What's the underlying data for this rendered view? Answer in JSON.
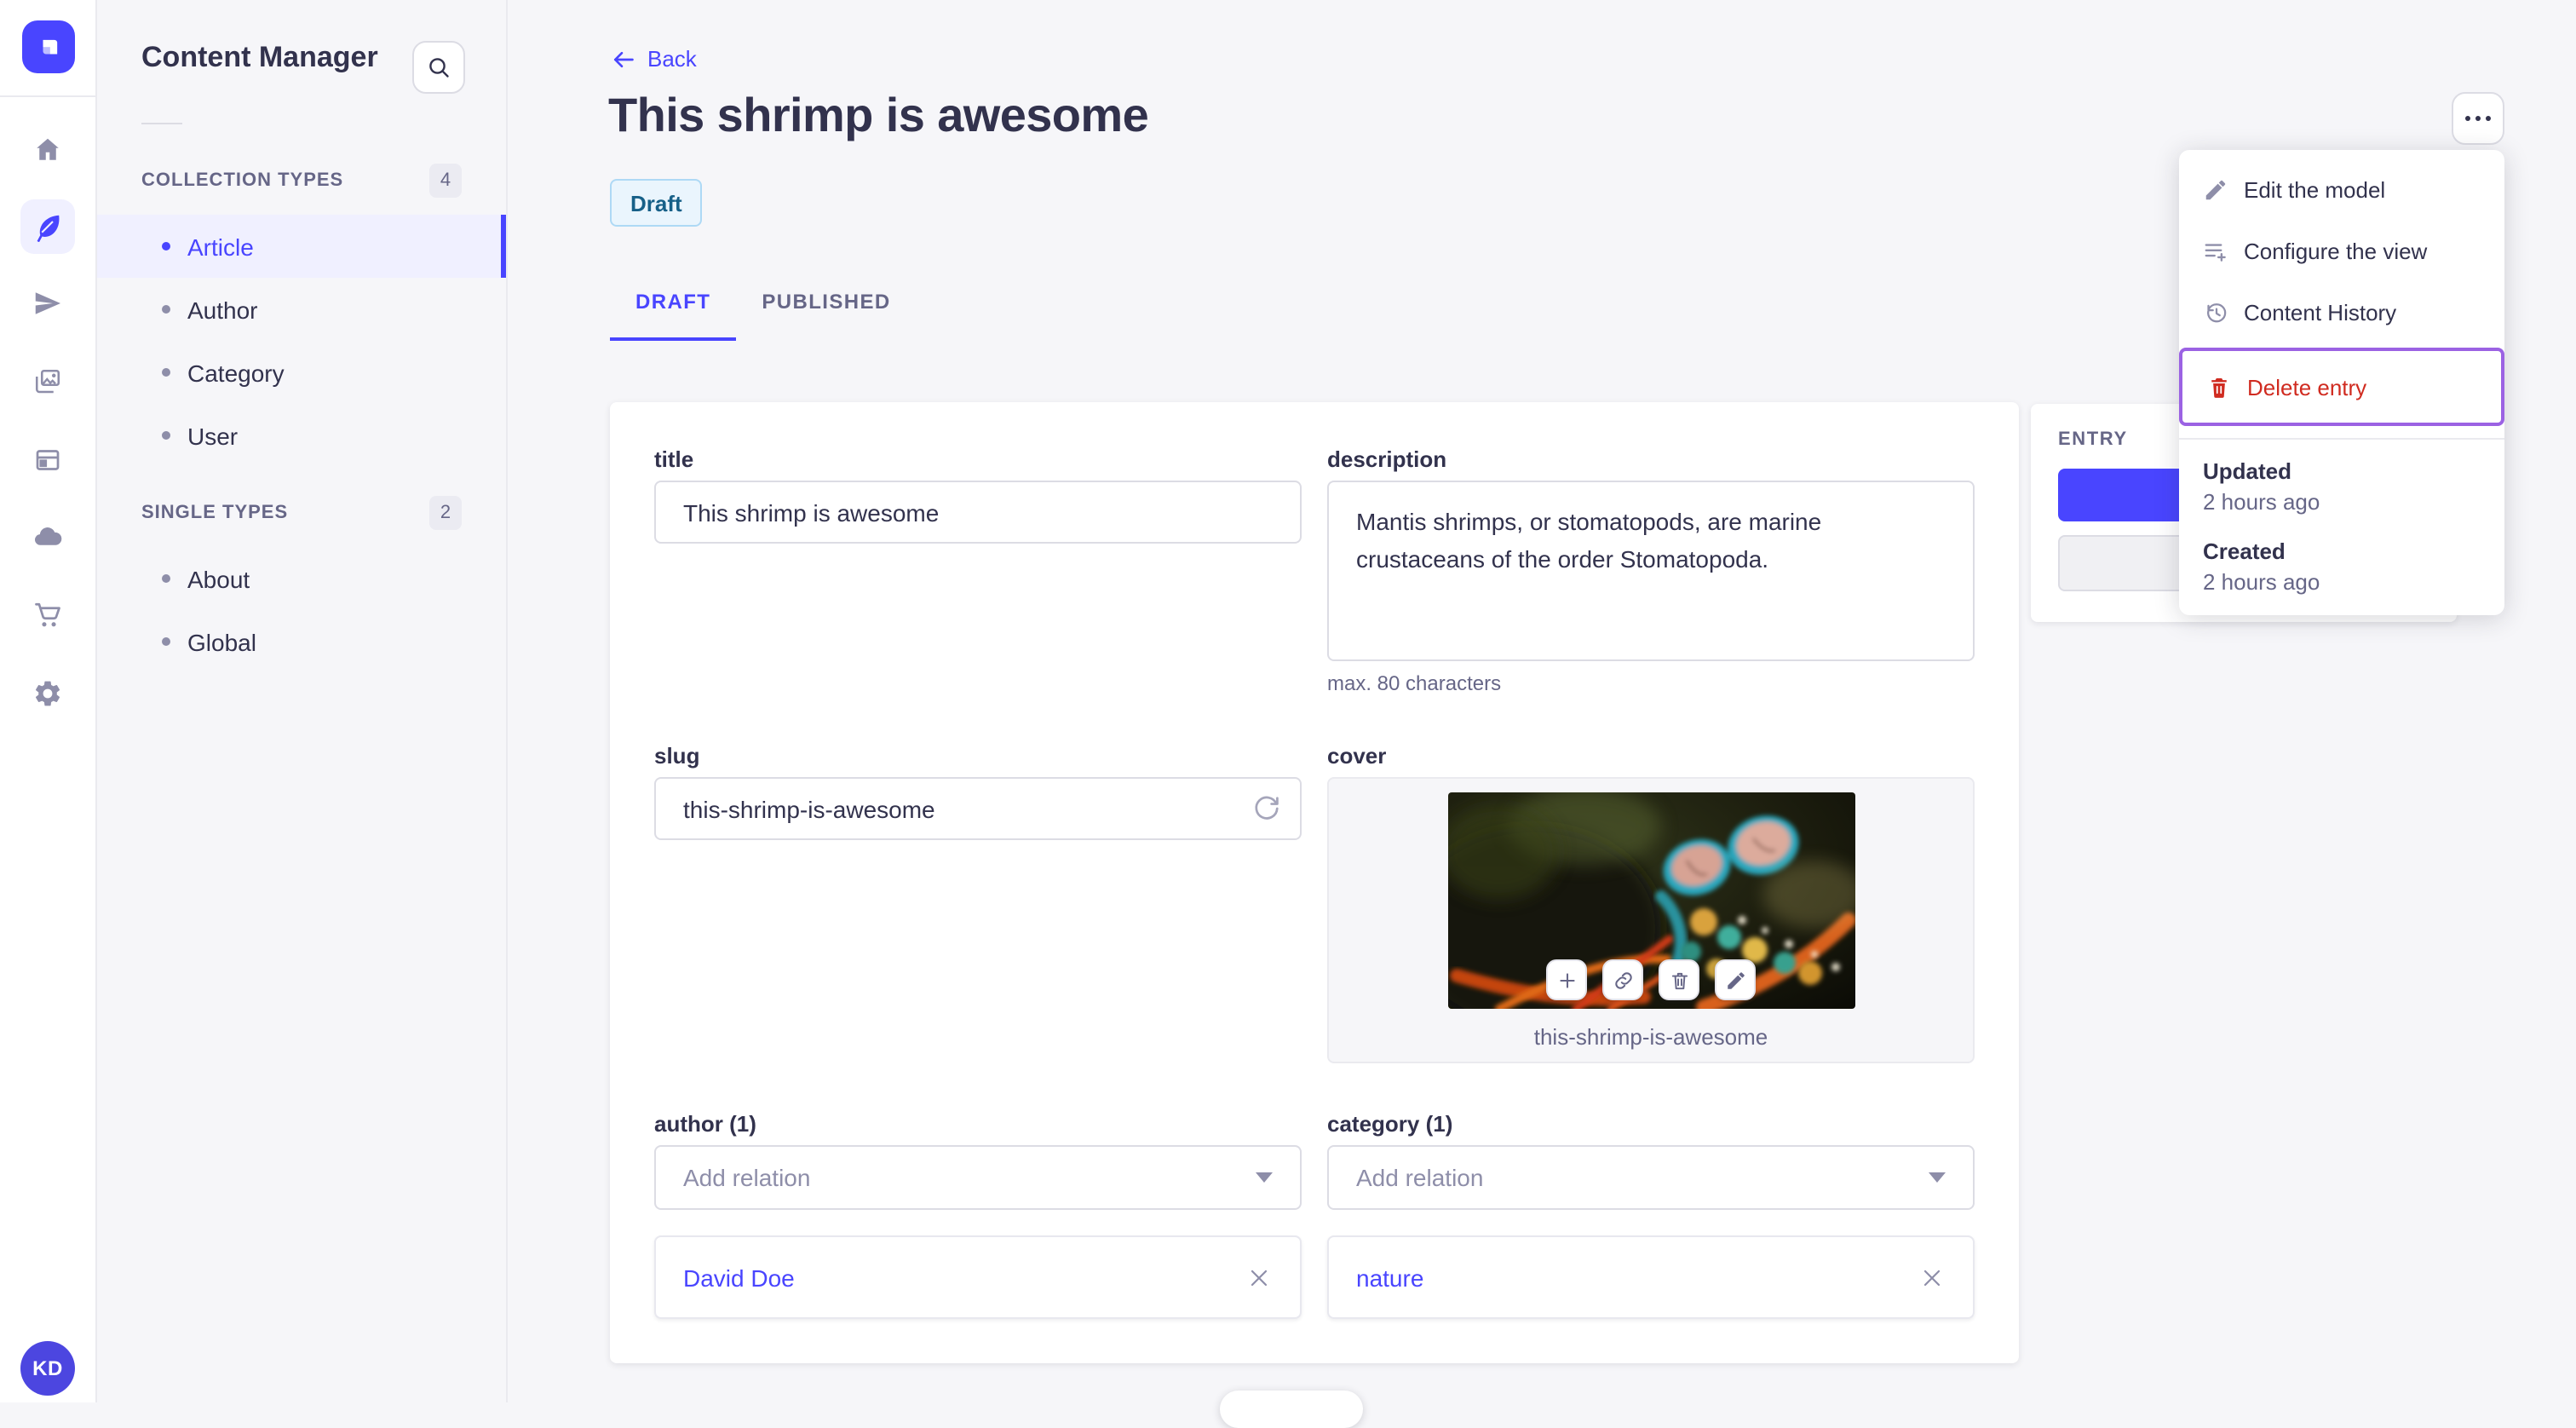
{
  "rail": {
    "logo": "strapi-logo",
    "icons": [
      "home",
      "content-manager",
      "releases",
      "media-library",
      "content-type-builder",
      "cloud",
      "marketplace",
      "settings"
    ],
    "avatar_initials": "KD"
  },
  "sidebar": {
    "title": "Content Manager",
    "search_icon": "search",
    "sections": [
      {
        "label": "COLLECTION TYPES",
        "badge": "4",
        "items": [
          {
            "label": "Article",
            "active": true
          },
          {
            "label": "Author",
            "active": false
          },
          {
            "label": "Category",
            "active": false
          },
          {
            "label": "User",
            "active": false
          }
        ]
      },
      {
        "label": "SINGLE TYPES",
        "badge": "2",
        "items": [
          {
            "label": "About",
            "active": false
          },
          {
            "label": "Global",
            "active": false
          }
        ]
      }
    ]
  },
  "header": {
    "back_label": "Back",
    "title": "This shrimp is awesome",
    "status_badge": "Draft",
    "tabs": [
      {
        "label": "DRAFT",
        "active": true
      },
      {
        "label": "PUBLISHED",
        "active": false
      }
    ]
  },
  "form": {
    "title": {
      "label": "title",
      "value": "This shrimp is awesome"
    },
    "description": {
      "label": "description",
      "value": "Mantis shrimps, or stomatopods, are marine crustaceans of the order Stomatopoda.",
      "hint": "max. 80 characters"
    },
    "slug": {
      "label": "slug",
      "value": "this-shrimp-is-awesome"
    },
    "cover": {
      "label": "cover",
      "caption": "this-shrimp-is-awesome",
      "actions": [
        "add-media",
        "copy-link",
        "delete-media",
        "edit-media"
      ]
    },
    "author": {
      "label": "author (1)",
      "placeholder": "Add relation",
      "items": [
        {
          "label": "David Doe"
        }
      ]
    },
    "category": {
      "label": "category (1)",
      "placeholder": "Add relation",
      "items": [
        {
          "label": "nature"
        }
      ]
    }
  },
  "entry_panel": {
    "label": "ENTRY"
  },
  "menu": {
    "items": [
      {
        "label": "Edit the model",
        "icon": "pencil"
      },
      {
        "label": "Configure the view",
        "icon": "configure-list"
      },
      {
        "label": "Content History",
        "icon": "history"
      },
      {
        "label": "Delete entry",
        "icon": "trash",
        "danger": true,
        "focused": true
      }
    ],
    "meta": {
      "updated_label": "Updated",
      "updated_value": "2 hours ago",
      "created_label": "Created",
      "created_value": "2 hours ago"
    }
  },
  "colors": {
    "accent": "#4945FF",
    "accent_bg": "#F0F0FF",
    "danger": "#D02B20",
    "focus_ring": "#9B62E3",
    "draft_bg": "#EAF5FD",
    "draft_border": "#AED9F5",
    "draft_text": "#176088"
  }
}
